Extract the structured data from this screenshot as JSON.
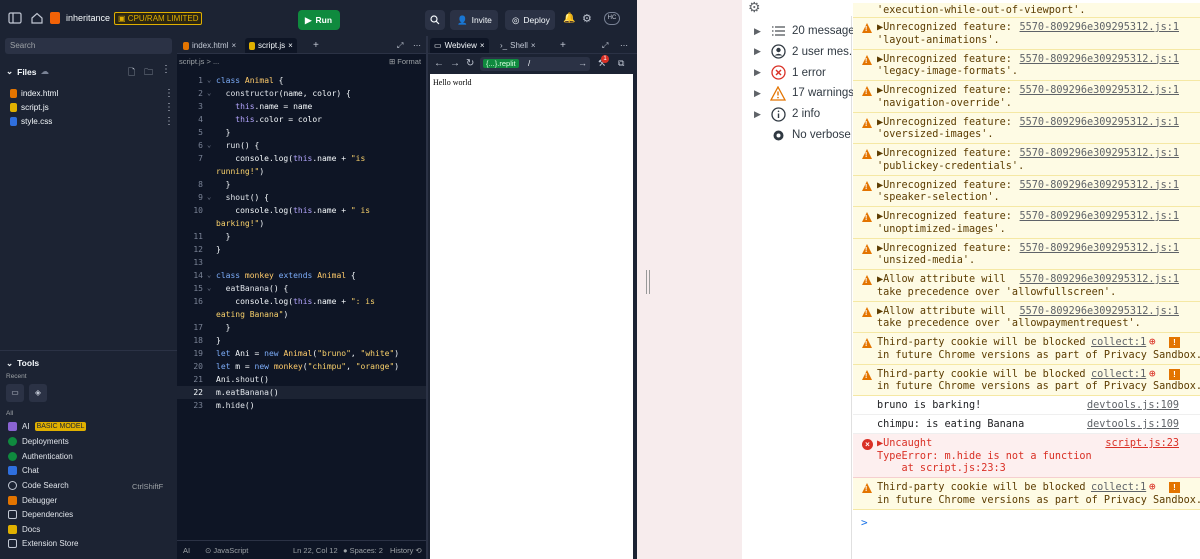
{
  "replit": {
    "repl_name": "inheritance",
    "plan_badge": "CPU/RAM LIMITED",
    "run_label": "Run",
    "invite_label": "Invite",
    "deploy_label": "Deploy",
    "avatar": "HC",
    "search_placeholder": "Search",
    "files_title": "Files",
    "files": [
      "index.html",
      "script.js",
      "style.css"
    ],
    "tools_title": "Tools",
    "recent_label": "Recent",
    "all_label": "All",
    "tools": [
      {
        "label": "AI",
        "badge": "BASIC MODEL",
        "color": "#8a63d2"
      },
      {
        "label": "Deployments",
        "color": "#0f8a3e"
      },
      {
        "label": "Authentication",
        "color": "#0f8a3e"
      },
      {
        "label": "Chat",
        "color": "#2f6fde"
      },
      {
        "label": "Code Search",
        "shortcut": "CtrlShiftF",
        "color": "#c2c8d4"
      },
      {
        "label": "Debugger",
        "color": "#e37400"
      },
      {
        "label": "Dependencies",
        "color": "#c2c8d4"
      },
      {
        "label": "Docs",
        "color": "#e0b000"
      },
      {
        "label": "Extension Store",
        "color": "#c2c8d4"
      }
    ],
    "editor_tabs": [
      "index.html",
      "script.js"
    ],
    "breadcrumb": "script.js > ...",
    "format_label": "Format",
    "code_lines": [
      {
        "n": "1",
        "fold": true,
        "html": "<span class='kw'>class</span> <span class='cls'>Animal</span> {"
      },
      {
        "n": "2",
        "fold": true,
        "html": "  <span class='fn'>constructor</span>(name, color) {"
      },
      {
        "n": "3",
        "html": "    <span class='th'>this</span>.name = name"
      },
      {
        "n": "4",
        "html": "    <span class='th'>this</span>.color = color"
      },
      {
        "n": "5",
        "html": "  }"
      },
      {
        "n": "6",
        "fold": true,
        "html": "  <span class='fn'>run</span>() {"
      },
      {
        "n": "7",
        "html": "    console.log(<span class='th'>this</span>.name + <span class='str'>\"is</span>"
      },
      {
        "n": "",
        "html": "<span class='str'>running!\"</span>)"
      },
      {
        "n": "8",
        "html": "  }"
      },
      {
        "n": "9",
        "fold": true,
        "html": "  <span class='fn'>shout</span>() {"
      },
      {
        "n": "10",
        "html": "    console.log(<span class='th'>this</span>.name + <span class='str'>\" is</span>"
      },
      {
        "n": "",
        "html": "<span class='str'>barking!\"</span>)"
      },
      {
        "n": "11",
        "html": "  }"
      },
      {
        "n": "12",
        "html": "}"
      },
      {
        "n": "13",
        "html": ""
      },
      {
        "n": "14",
        "fold": true,
        "html": "<span class='kw'>class</span> <span class='cls'>monkey</span> <span class='kw'>extends</span> <span class='cls'>Animal</span> {"
      },
      {
        "n": "15",
        "fold": true,
        "html": "  <span class='fn'>eatBanana</span>() {"
      },
      {
        "n": "16",
        "html": "    console.log(<span class='th'>this</span>.name + <span class='str'>\": is</span>"
      },
      {
        "n": "",
        "html": "<span class='str'>eating Banana\"</span>)"
      },
      {
        "n": "17",
        "html": "  }"
      },
      {
        "n": "18",
        "html": "}"
      },
      {
        "n": "19",
        "html": "<span class='kw'>let</span> Ani = <span class='kw'>new</span> <span class='cls'>Animal</span>(<span class='str'>\"bruno\"</span>, <span class='str'>\"white\"</span>)"
      },
      {
        "n": "20",
        "html": "<span class='kw'>let</span> m = <span class='kw'>new</span> <span class='cls'>monkey</span>(<span class='str'>\"chimpu\"</span>, <span class='str'>\"orange\"</span>)"
      },
      {
        "n": "21",
        "html": "Ani.<span class='fn'>shout</span>()"
      },
      {
        "n": "22",
        "html": "m.<span class='fn'>eatBanana</span>()"
      },
      {
        "n": "23",
        "html": "m.<span class='fn'>hide</span>()"
      }
    ],
    "status": {
      "ai": "AI",
      "lang": "JavaScript",
      "pos": "Ln 22, Col 12",
      "spaces": "Spaces: 2",
      "history": "History"
    },
    "webview_tab": "Webview",
    "shell_tab": "Shell",
    "url": ".replit",
    "url_path": "/",
    "page_output": "Hello world",
    "badge_count": "1"
  },
  "devtools": {
    "filters": [
      {
        "label": "20 messages",
        "icon": "list"
      },
      {
        "label": "2 user mes...",
        "icon": "user"
      },
      {
        "label": "1 error",
        "icon": "error"
      },
      {
        "label": "17 warnings",
        "icon": "warning"
      },
      {
        "label": "2 info",
        "icon": "info"
      },
      {
        "label": "No verbose",
        "icon": "verbose"
      }
    ],
    "messages": [
      {
        "type": "warn",
        "lines": [
          "'execution-while-out-of-viewport'."
        ],
        "src": "",
        "partial": true
      },
      {
        "type": "warn",
        "lines": [
          "▶Unrecognized feature:",
          "'layout-animations'."
        ],
        "src": "5570-809296e309295312.js:1"
      },
      {
        "type": "warn",
        "lines": [
          "▶Unrecognized feature:",
          "'legacy-image-formats'."
        ],
        "src": "5570-809296e309295312.js:1"
      },
      {
        "type": "warn",
        "lines": [
          "▶Unrecognized feature:",
          "'navigation-override'."
        ],
        "src": "5570-809296e309295312.js:1"
      },
      {
        "type": "warn",
        "lines": [
          "▶Unrecognized feature:",
          "'oversized-images'."
        ],
        "src": "5570-809296e309295312.js:1"
      },
      {
        "type": "warn",
        "lines": [
          "▶Unrecognized feature:",
          "'publickey-credentials'."
        ],
        "src": "5570-809296e309295312.js:1"
      },
      {
        "type": "warn",
        "lines": [
          "▶Unrecognized feature:",
          "'speaker-selection'."
        ],
        "src": "5570-809296e309295312.js:1"
      },
      {
        "type": "warn",
        "lines": [
          "▶Unrecognized feature:",
          "'unoptimized-images'."
        ],
        "src": "5570-809296e309295312.js:1"
      },
      {
        "type": "warn",
        "lines": [
          "▶Unrecognized feature:",
          "'unsized-media'."
        ],
        "src": "5570-809296e309295312.js:1"
      },
      {
        "type": "warn",
        "lines": [
          "▶Allow attribute will",
          "take precedence over 'allowfullscreen'."
        ],
        "src": "5570-809296e309295312.js:1"
      },
      {
        "type": "warn",
        "lines": [
          "▶Allow attribute will",
          "take precedence over 'allowpaymentrequest'."
        ],
        "src": "5570-809296e309295312.js:1"
      },
      {
        "type": "warn",
        "lines": [
          "Third-party cookie will be blocked",
          "in future Chrome versions as part of Privacy Sandbox."
        ],
        "src": "collect:1",
        "cookie": true
      },
      {
        "type": "warn",
        "lines": [
          "Third-party cookie will be blocked",
          "in future Chrome versions as part of Privacy Sandbox."
        ],
        "src": "collect:1",
        "cookie": true
      },
      {
        "type": "log",
        "lines": [
          "bruno is barking!"
        ],
        "src": "devtools.js:109"
      },
      {
        "type": "log",
        "lines": [
          "chimpu: is eating Banana"
        ],
        "src": "devtools.js:109"
      },
      {
        "type": "err",
        "lines": [
          "▶Uncaught",
          "TypeError: m.hide is not a function",
          "    at script.js:23:3"
        ],
        "src": "script.js:23"
      },
      {
        "type": "warn",
        "lines": [
          "Third-party cookie will be blocked",
          "in future Chrome versions as part of Privacy Sandbox."
        ],
        "src": "collect:1",
        "cookie": true
      }
    ],
    "prompt": ">"
  }
}
